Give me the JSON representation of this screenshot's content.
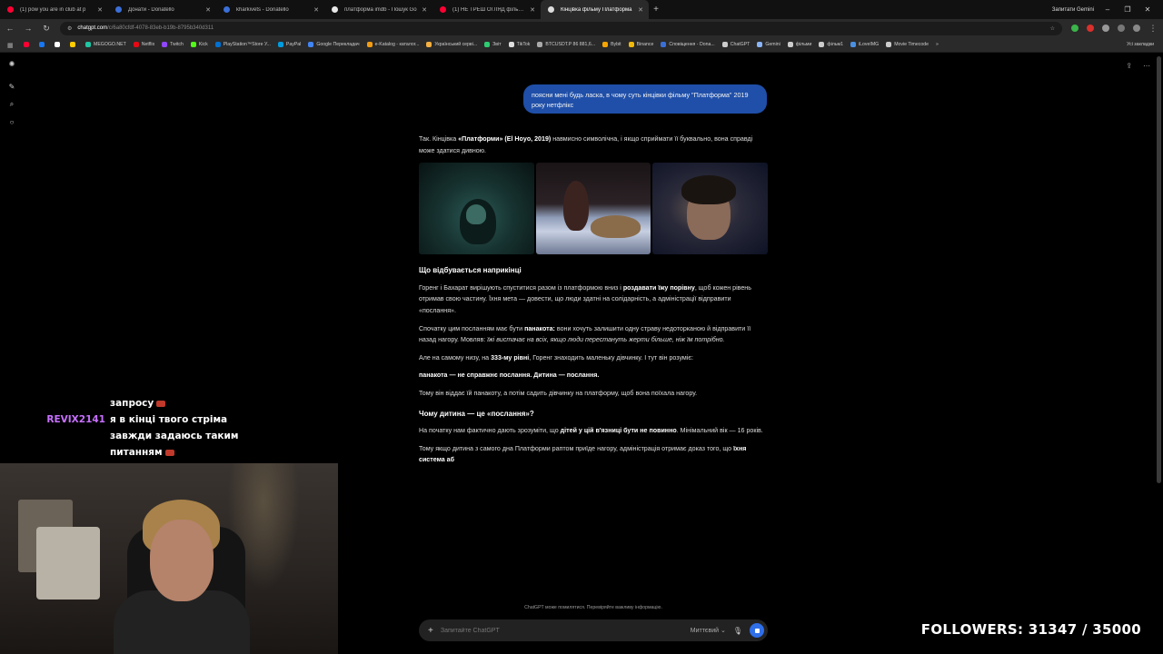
{
  "browser": {
    "tabs": [
      {
        "title": "(1) pow you are in club at p",
        "favicon_color": "#ff0033",
        "active": false
      },
      {
        "title": "Донати - Donatello",
        "favicon_color": "#3b6fd8",
        "active": false
      },
      {
        "title": "kharkivets - Donatello",
        "favicon_color": "#3b6fd8",
        "active": false
      },
      {
        "title": "платформа imdb - Пошук Go",
        "favicon_color": "#e8e8e8",
        "active": false
      },
      {
        "title": "(1) НЕ ТРЕШ ОГЛЯД фільму П",
        "favicon_color": "#ff0033",
        "active": false
      },
      {
        "title": "Кінцівка фільму Платформа",
        "favicon_color": "#dddddd",
        "active": true
      }
    ],
    "new_tab": "+",
    "gemini_label": "Запитати Gemini",
    "url_host": "chatgpt.com",
    "url_path": "/c/6a80cfdf-4078-83eb-b19b-8795b340d311",
    "bookmarks": [
      {
        "label": "",
        "color": "#ff0033"
      },
      {
        "label": "",
        "color": "#1877f2"
      },
      {
        "label": "",
        "color": "#ffffff"
      },
      {
        "label": "",
        "color": "#ffcc00"
      },
      {
        "label": "MEGOGO.NET",
        "color": "#1fc6a4"
      },
      {
        "label": "Netflix",
        "color": "#e50914"
      },
      {
        "label": "Twitch",
        "color": "#9146ff"
      },
      {
        "label": "Kick",
        "color": "#53fc18"
      },
      {
        "label": "PlayStation™Store У...",
        "color": "#0070d1"
      },
      {
        "label": "PayPal",
        "color": "#009cde"
      },
      {
        "label": "Google Перекладач",
        "color": "#4285f4"
      },
      {
        "label": "e-Katalog - каталог...",
        "color": "#f39c12"
      },
      {
        "label": "Український серві...",
        "color": "#f5b041"
      },
      {
        "label": "Звіт",
        "color": "#2ecc71"
      },
      {
        "label": "TikTok",
        "color": "#dddddd"
      },
      {
        "label": "BTCUSDT.P 86 881,6...",
        "color": "#aaaaaa"
      },
      {
        "label": "Bybit",
        "color": "#f7a600"
      },
      {
        "label": "Binance",
        "color": "#f0b90b"
      },
      {
        "label": "Сповіщення - Dona...",
        "color": "#3b6fd8"
      },
      {
        "label": "ChatGPT",
        "color": "#cccccc"
      },
      {
        "label": "Gemini",
        "color": "#8ab4f8"
      },
      {
        "label": "фільми",
        "color": "#cccccc"
      },
      {
        "label": "фільм1",
        "color": "#cccccc"
      },
      {
        "label": "iLoveIMG",
        "color": "#4a90e2"
      },
      {
        "label": "Movie Timecode",
        "color": "#cccccc"
      }
    ],
    "bookmarks_more": "»",
    "all_bookmarks": "Усі закладки"
  },
  "chat": {
    "user_message": "поясни мені будь ласка, в чому суть кінцівки фільму \"Платформа\" 2019 року нетфлікс",
    "intro_a": "Так. Кінцівка ",
    "intro_b": "«Платформи» (El Hoyo, 2019)",
    "intro_c": " навмисно символічна, і якщо сприймати її буквально, вона справді може здатися дивною.",
    "h1": "Що відбувається наприкінці",
    "p1_a": "Горенг і Бахарат вирішують спуститися разом із платформою вниз і ",
    "p1_b": "роздавати їжу порівну",
    "p1_c": ", щоб кожен рівень отримав свою частину. Їхня мета — довести, що люди здатні на солідарність, а адміністрації відправити «послання».",
    "p2_a": "Спочатку цим посланням має бути ",
    "p2_b": "панакота:",
    "p2_c": " вони хочуть залишити одну страву недоторканою й відправити її назад нагору. Мовляв: ",
    "p2_d": "їжі вистачає на всіх, якщо люди перестануть жерти більше, ніж їм потрібно.",
    "p3_a": "Але на самому низу, на ",
    "p3_b": "333-му рівні",
    "p3_c": ", Горенг знаходить маленьку дівчинку. І тут він розуміє:",
    "p4": "панакота — не справжнє послання. Дитина — послання.",
    "p5": "Тому він віддає їй панакоту, а потім садить дівчинку на платформу, щоб вона поїхала нагору.",
    "h2": "Чому дитина — це «послання»?",
    "p6_a": "На початку нам фактично дають зрозуміти, що ",
    "p6_b": "дітей у цій в'язниці бути не повинно",
    "p6_c": ". Мінімальний вік — 16 років.",
    "p7_a": "Тому якщо дитина з самого дна Платформи раптом приїде нагору, адміністрація отримає доказ того, що ",
    "p7_b": "їхня система аб"
  },
  "composer": {
    "placeholder": "Запитайте ChatGPT",
    "mode": "Миттєвий ⌄",
    "disclaimer": "ChatGPT може помилятися. Перевіряйте важливу інформацію."
  },
  "overlay": {
    "chat_line0": "запросу",
    "chat_user": "REVIX2141",
    "chat_line1": "я в кінці твого стріма",
    "chat_line2": "завжди задаюсь таким",
    "chat_line3": "питанням",
    "followers": "FOLLOWERS: 31347 / 35000"
  }
}
